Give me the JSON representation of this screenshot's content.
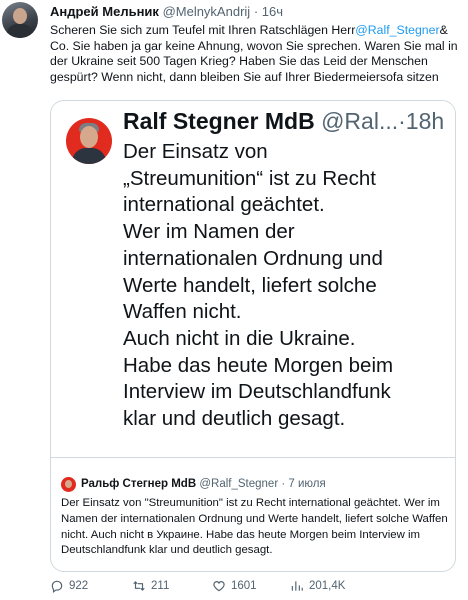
{
  "tweet": {
    "author_name": "Андрей Мельник",
    "author_handle": "@MelnykAndrij",
    "dot": "·",
    "time": "16ч",
    "text_before": "Scheren Sie sich zum Teufel mit Ihren Ratschlägen Herr",
    "mention": "@Ralf_Stegner",
    "text_after": "& Co. Sie haben ja gar keine Ahnung, wovon Sie sprechen. Waren Sie mal in der Ukraine seit 500 Tagen Krieg? Haben Sie das Leid der Menschen gespürt? Wenn nicht, dann bleiben Sie auf Ihrer Biedermeiersofa sitzen"
  },
  "screenshot_tweet": {
    "name": "Ralf Stegner MdB",
    "handle": "@Ral...",
    "dot": "·",
    "time": "18h",
    "lines": [
      "Der Einsatz von",
      "„Streumunition“ ist zu Recht",
      "international geächtet.",
      "Wer im Namen der",
      "internationalen Ordnung und",
      "Werte handelt, liefert solche",
      "Waffen nicht.",
      "Auch nicht in die Ukraine.",
      "Habe das heute Morgen beim",
      "Interview im Deutschlandfunk",
      "klar und deutlich gesagt."
    ]
  },
  "quoted_tweet": {
    "name": "Ральф Стегнер MdB",
    "handle": "@Ralf_Stegner",
    "dot": "·",
    "date": "7 июля",
    "text": "Der Einsatz von \"Streumunition\" ist zu Recht international geächtet. Wer im Namen der internationalen Ordnung und Werte handelt, liefert solche Waffen nicht. Auch nicht в Украине. Habe das heute Morgen beim Interview im Deutschlandfunk klar und deutlich gesagt."
  },
  "actions": {
    "replies": "922",
    "retweets": "211",
    "likes": "1601",
    "views": "201,4K"
  },
  "colors": {
    "link": "#1d9bf0",
    "secondary_text": "#536471",
    "border": "#cfd9de"
  },
  "icons": [
    "reply-icon",
    "retweet-icon",
    "like-icon",
    "views-icon"
  ]
}
